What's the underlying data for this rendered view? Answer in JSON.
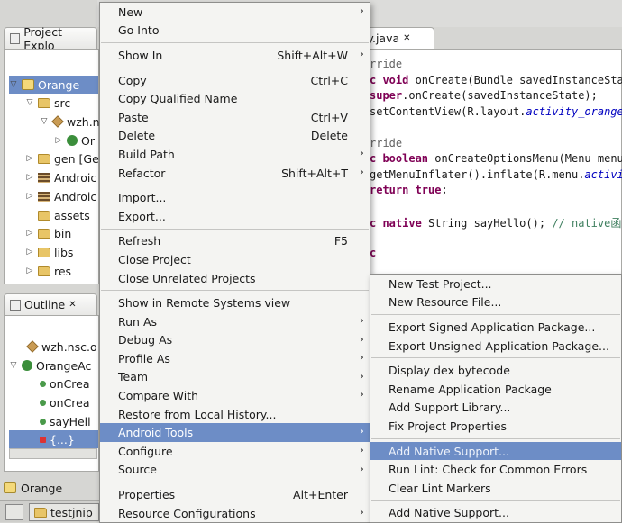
{
  "project_explorer": {
    "tab_title": "Project Explo",
    "tree": [
      {
        "label": "Orange",
        "selected": true
      },
      {
        "label": "src"
      },
      {
        "label": "wzh.n"
      },
      {
        "label": "Or"
      },
      {
        "label": "gen [Ge"
      },
      {
        "label": "Androic"
      },
      {
        "label": "Androic"
      },
      {
        "label": "assets"
      },
      {
        "label": "bin"
      },
      {
        "label": "libs"
      },
      {
        "label": "res"
      }
    ]
  },
  "outline": {
    "tab_title": "Outline",
    "tree": [
      {
        "label": "wzh.nsc.o"
      },
      {
        "label": "OrangeAc"
      },
      {
        "label": "onCrea"
      },
      {
        "label": "onCrea"
      },
      {
        "label": "sayHell"
      },
      {
        "label": "{...}"
      }
    ]
  },
  "status_bar": {
    "project": "Orange"
  },
  "taskbar": {
    "item": "testjnip"
  },
  "editor": {
    "tab_title": "ity.java",
    "lines": [
      {
        "segs": [
          {
            "t": "rride",
            "c": "ann"
          }
        ]
      },
      {
        "segs": [
          {
            "t": "c ",
            "c": "kw"
          },
          {
            "t": "void",
            "c": "kw"
          },
          {
            "t": " onCreate(Bundle savedInstanceSta",
            "c": ""
          }
        ]
      },
      {
        "segs": [
          {
            "t": "super",
            "c": "kw"
          },
          {
            "t": ".onCreate(savedInstanceState);",
            "c": ""
          }
        ]
      },
      {
        "segs": [
          {
            "t": "setContentView(R.layout.",
            "c": ""
          },
          {
            "t": "activity_orange",
            "c": "it"
          }
        ]
      },
      {
        "segs": [
          {
            "t": "",
            "c": ""
          }
        ]
      },
      {
        "segs": [
          {
            "t": "rride",
            "c": "ann"
          }
        ]
      },
      {
        "segs": [
          {
            "t": "c ",
            "c": "kw"
          },
          {
            "t": "boolean",
            "c": "kw"
          },
          {
            "t": " onCreateOptionsMenu(Menu menu",
            "c": ""
          }
        ]
      },
      {
        "segs": [
          {
            "t": "getMenuInflater().inflate(R.menu.",
            "c": ""
          },
          {
            "t": "activit",
            "c": "it"
          }
        ]
      },
      {
        "segs": [
          {
            "t": "return true",
            "c": "kw"
          },
          {
            "t": ";",
            "c": ""
          }
        ]
      },
      {
        "segs": [
          {
            "t": "",
            "c": ""
          }
        ]
      },
      {
        "segs": [
          {
            "t": "c ",
            "c": "kw"
          },
          {
            "t": "native",
            "c": "kw"
          },
          {
            "t": " String sayHello(); ",
            "c": ""
          },
          {
            "t": "// native函",
            "c": "cm"
          }
        ]
      },
      {
        "segs": [
          {
            "t": "",
            "c": ""
          }
        ]
      },
      {
        "segs": [
          {
            "t": "c",
            "c": "kw"
          }
        ]
      }
    ]
  },
  "context_menu": {
    "items": [
      {
        "label": "New",
        "accel": "",
        "submenu": true
      },
      {
        "label": "Go Into",
        "accel": ""
      },
      {
        "sep": true
      },
      {
        "label": "Show In",
        "accel": "Shift+Alt+W",
        "submenu": true
      },
      {
        "sep": true
      },
      {
        "label": "Copy",
        "accel": "Ctrl+C"
      },
      {
        "label": "Copy Qualified Name",
        "accel": ""
      },
      {
        "label": "Paste",
        "accel": "Ctrl+V"
      },
      {
        "label": "Delete",
        "accel": "Delete"
      },
      {
        "label": "Build Path",
        "accel": "",
        "submenu": true
      },
      {
        "label": "Refactor",
        "accel": "Shift+Alt+T",
        "submenu": true
      },
      {
        "sep": true
      },
      {
        "label": "Import...",
        "accel": ""
      },
      {
        "label": "Export...",
        "accel": ""
      },
      {
        "sep": true
      },
      {
        "label": "Refresh",
        "accel": "F5"
      },
      {
        "label": "Close Project",
        "accel": ""
      },
      {
        "label": "Close Unrelated Projects",
        "accel": ""
      },
      {
        "sep": true
      },
      {
        "label": "Show in Remote Systems view",
        "accel": ""
      },
      {
        "label": "Run As",
        "accel": "",
        "submenu": true
      },
      {
        "label": "Debug As",
        "accel": "",
        "submenu": true
      },
      {
        "label": "Profile As",
        "accel": "",
        "submenu": true
      },
      {
        "label": "Team",
        "accel": "",
        "submenu": true
      },
      {
        "label": "Compare With",
        "accel": "",
        "submenu": true
      },
      {
        "label": "Restore from Local History...",
        "accel": ""
      },
      {
        "label": "Android Tools",
        "accel": "",
        "submenu": true,
        "highlight": true
      },
      {
        "label": "Configure",
        "accel": "",
        "submenu": true
      },
      {
        "label": "Source",
        "accel": "",
        "submenu": true
      },
      {
        "sep": true
      },
      {
        "label": "Properties",
        "accel": "Alt+Enter"
      },
      {
        "label": "Resource Configurations",
        "accel": "",
        "submenu": true
      }
    ]
  },
  "android_tools_submenu": {
    "items": [
      {
        "label": "New Test Project..."
      },
      {
        "label": "New Resource File..."
      },
      {
        "sep": true
      },
      {
        "label": "Export Signed Application Package..."
      },
      {
        "label": "Export Unsigned Application Package..."
      },
      {
        "sep": true
      },
      {
        "label": "Display dex bytecode"
      },
      {
        "label": "Rename Application Package"
      },
      {
        "label": "Add Support Library..."
      },
      {
        "label": "Fix Project Properties"
      },
      {
        "sep": true
      },
      {
        "label": "Add Native Support...",
        "highlight": true,
        "disabled": true
      },
      {
        "label": "Run Lint: Check for Common Errors"
      },
      {
        "label": "Clear Lint Markers"
      },
      {
        "sep": true
      },
      {
        "label": "Add Native Support..."
      }
    ]
  },
  "colors": {
    "highlight": "#6d8dc6",
    "menu_bg": "#f4f4f2"
  }
}
